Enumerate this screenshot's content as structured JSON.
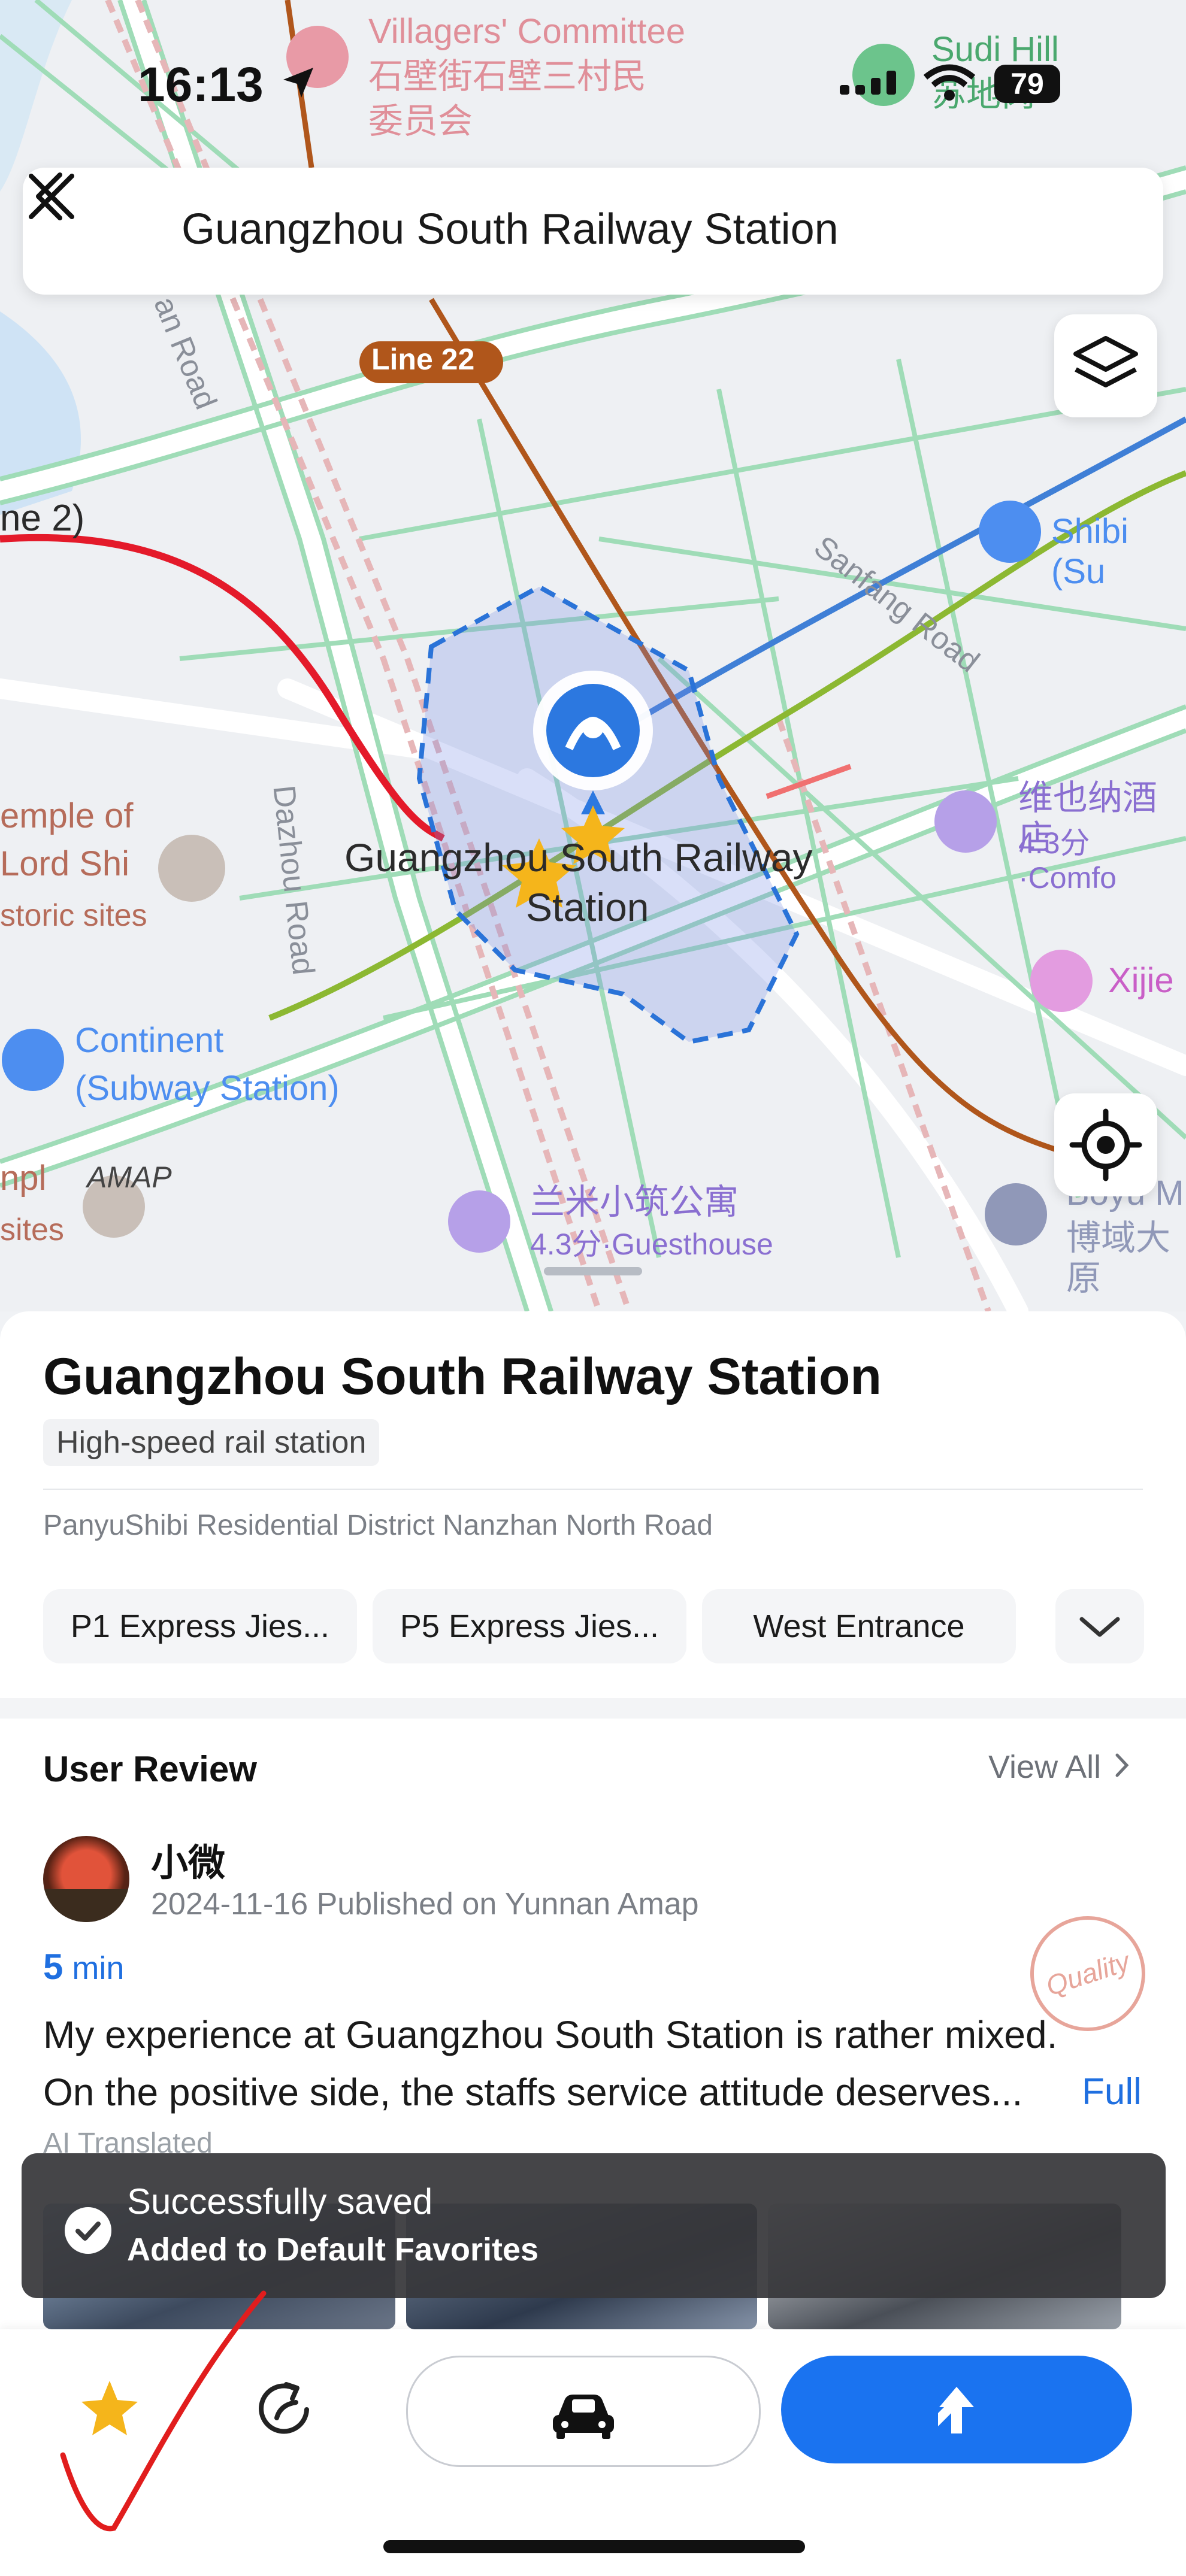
{
  "status_bar": {
    "time": "16:13",
    "battery": "79"
  },
  "search": {
    "query": "Guangzhou South Railway Station"
  },
  "map": {
    "labels": {
      "villagers_committee": "Villagers' Committee",
      "villagers_committee_cn1": "石壁街石壁三村民",
      "villagers_committee_cn2": "委员会",
      "sudi_hill": "Sudi Hill",
      "sudi_hill_cn": "苏地岗",
      "line22": "Line 22",
      "line2_partial": "ne 2)",
      "an_road": "an Road",
      "sanfang_road": "Sanfang Road",
      "shibi": "Shibi (Su",
      "temple1": "emple of",
      "temple2": "Lord Shi",
      "temple3": "storic sites",
      "dazhou_road": "Dazhou Road",
      "station_line1": "Guangzhou South Railway",
      "station_line2": "Station",
      "hotel_cn": "维也纳酒店",
      "hotel_rating": "4.3分·Comfo",
      "xijie": "Xijie",
      "continent1": "Continent",
      "continent2": "(Subway Station)",
      "amap": "AMAP",
      "npl": "npl",
      "sites": "sites",
      "lanmi_cn": "兰米小筑公寓",
      "lanmi_rating": "4.3分·Guesthouse",
      "boyu": "Boyu M",
      "boyu_cn": "博域大原"
    }
  },
  "place": {
    "name": "Guangzhou South Railway Station",
    "category": "High-speed rail station",
    "address": "PanyuShibi Residential District Nanzhan North Road",
    "entrances": [
      "P1 Express Jies...",
      "P5 Express Jies...",
      "West Entrance"
    ]
  },
  "review": {
    "section_title": "User Review",
    "view_all": "View All",
    "user": "小微",
    "meta": "2024-11-16 Published on Yunnan  Amap",
    "time_value": "5",
    "time_unit": " min",
    "badge": "Quality",
    "body_line1": "My experience at Guangzhou South Station is rather mixed.",
    "body_line2": "On the positive side, the staffs service attitude deserves...",
    "full": "Full",
    "ai_note": "AI Translated"
  },
  "toast": {
    "title": "Successfully saved",
    "subtitle": "Added to Default Favorites"
  },
  "bottom_bar": {
    "favorite_icon": "star-icon",
    "share_icon": "share-icon",
    "drive_icon": "car-icon",
    "navigate_icon": "navigate-arrow-icon"
  },
  "colors": {
    "accent_blue": "#1a73f0",
    "star": "#f5b51b",
    "annotation_red": "#e11d1d"
  }
}
